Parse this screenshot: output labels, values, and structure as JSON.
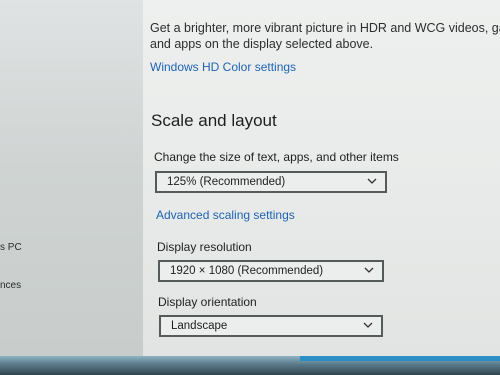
{
  "sidebar": {
    "items": [
      {
        "label": "s PC"
      },
      {
        "label": "nces"
      }
    ]
  },
  "hdr": {
    "description_line1": "Get a brighter, more vibrant picture in HDR and WCG videos, gam",
    "description_line2": "and apps on the display selected above.",
    "link": "Windows HD Color settings"
  },
  "scale_layout": {
    "title": "Scale and layout",
    "scale_label": "Change the size of text, apps, and other items",
    "scale_value": "125% (Recommended)",
    "advanced_link": "Advanced scaling settings",
    "resolution_label": "Display resolution",
    "resolution_value": "1920 × 1080 (Recommended)",
    "orientation_label": "Display orientation",
    "orientation_value": "Landscape"
  },
  "icons": {
    "dropdown": "chevron-down-icon"
  },
  "colors": {
    "link": "#1d63b3",
    "taskbar_accent": "#1e89c9"
  }
}
